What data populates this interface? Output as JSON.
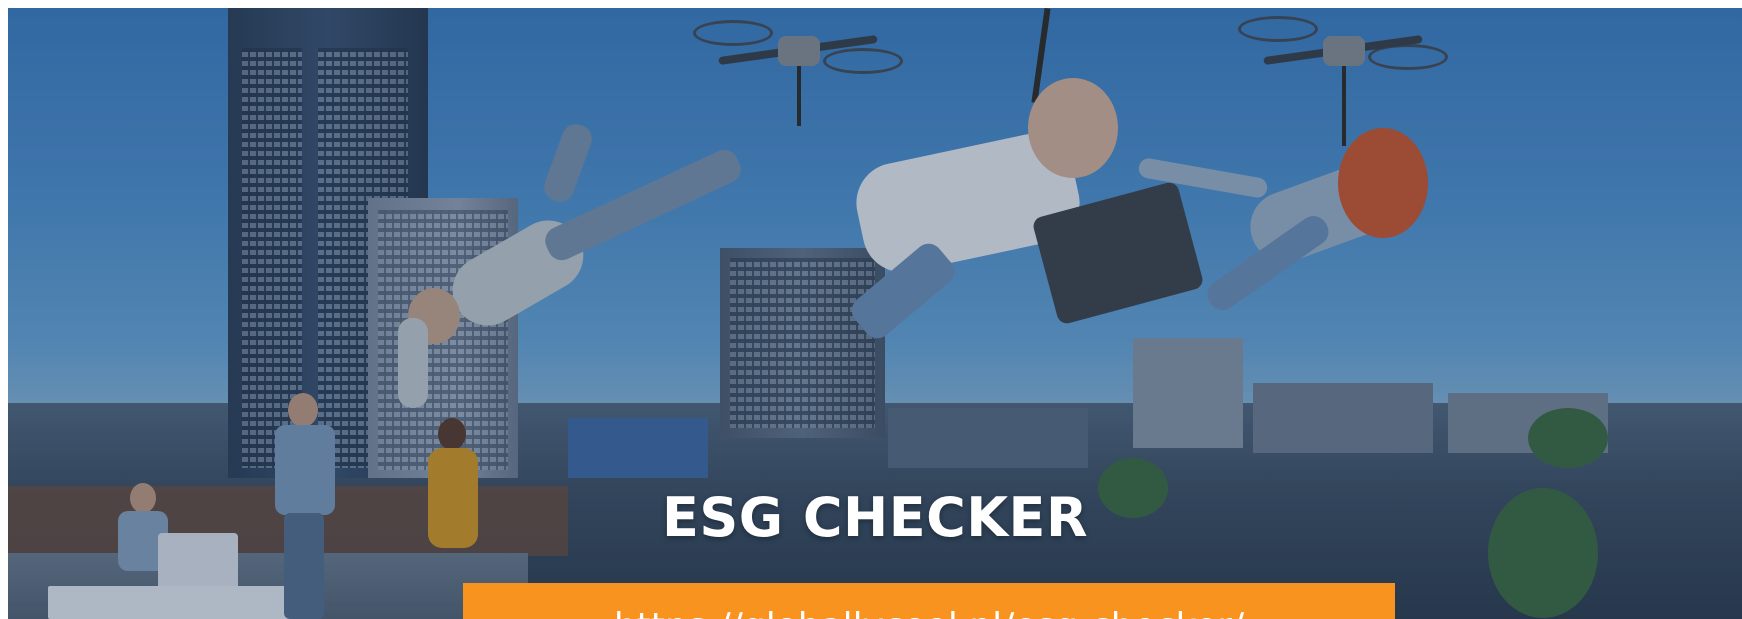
{
  "hero": {
    "title": "ESG CHECKER",
    "url_text": "https://globallycool.nl/esg-checker/"
  },
  "colors": {
    "banner": "#f7931e",
    "title": "#ffffff",
    "sky": "#4f92cf"
  },
  "scene": {
    "drones": [
      "drone-icon",
      "drone-icon",
      "drone-icon"
    ],
    "people_flying": 3
  }
}
